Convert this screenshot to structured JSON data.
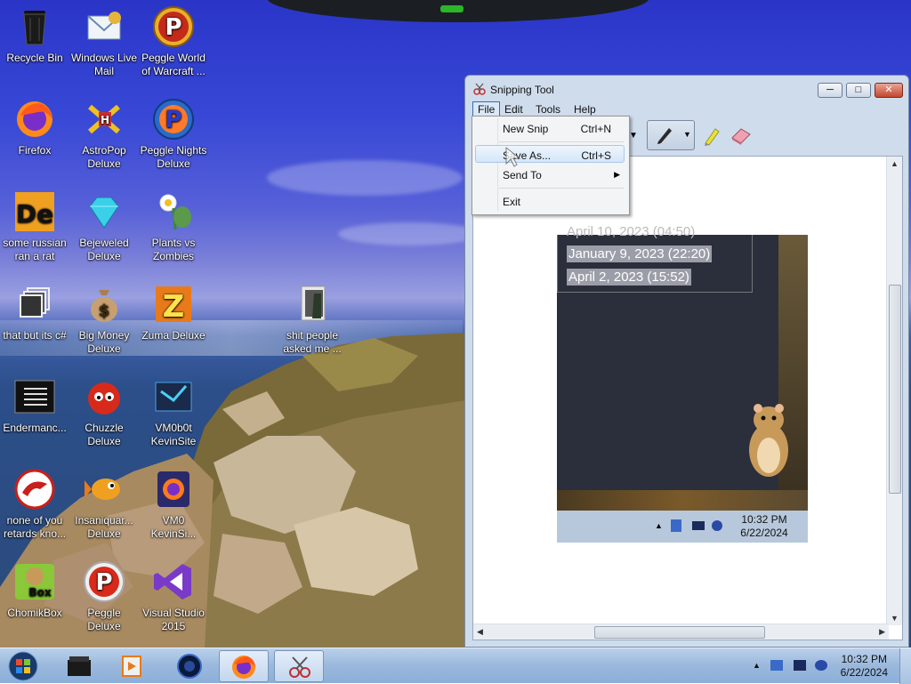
{
  "desktop_icons": [
    {
      "name": "recycle-bin",
      "label": "Recycle Bin"
    },
    {
      "name": "windows-live-mail",
      "label": "Windows Live Mail"
    },
    {
      "name": "peggle-world-of-warcraft",
      "label": "Peggle World of Warcraft ..."
    },
    {
      "name": "firefox",
      "label": "Firefox"
    },
    {
      "name": "astropop-deluxe",
      "label": "AstroPop Deluxe"
    },
    {
      "name": "peggle-nights-deluxe",
      "label": "Peggle Nights Deluxe"
    },
    {
      "name": "some-russian-ran-a-rat",
      "label": "some russian ran a rat"
    },
    {
      "name": "bejeweled-deluxe",
      "label": "Bejeweled Deluxe"
    },
    {
      "name": "plants-vs-zombies",
      "label": "Plants vs Zombies"
    },
    {
      "name": "that-but-its-csharp",
      "label": "that but its c#"
    },
    {
      "name": "big-money-deluxe",
      "label": "Big Money Deluxe"
    },
    {
      "name": "zuma-deluxe",
      "label": "Zuma Deluxe"
    },
    {
      "name": "shit-people-asked-me",
      "label": "shit people asked me ..."
    },
    {
      "name": "endermanc",
      "label": "Endermanc..."
    },
    {
      "name": "chuzzle-deluxe",
      "label": "Chuzzle Deluxe"
    },
    {
      "name": "vm0b0t-kevinsite",
      "label": "VM0b0t KevinSite"
    },
    {
      "name": "none-of-you-retards",
      "label": "none of you retards kno..."
    },
    {
      "name": "insaniquarium-deluxe",
      "label": "Insaniquar... Deluxe"
    },
    {
      "name": "vm0-kevinsi",
      "label": "VM0 KevinSi..."
    },
    {
      "name": "chomikbox",
      "label": "ChomikBox"
    },
    {
      "name": "peggle-deluxe",
      "label": "Peggle Deluxe"
    },
    {
      "name": "visual-studio-2015",
      "label": "Visual Studio 2015"
    }
  ],
  "snipping_tool": {
    "title": "Snipping Tool",
    "menus": [
      "File",
      "Edit",
      "Tools",
      "Help"
    ],
    "file_menu": {
      "items": [
        {
          "label": "New Snip",
          "shortcut": "Ctrl+N"
        },
        {
          "label": "Save As...",
          "shortcut": "Ctrl+S"
        },
        {
          "label": "Send To",
          "shortcut": ""
        },
        {
          "label": "Exit",
          "shortcut": ""
        }
      ]
    },
    "capture": {
      "line_cut": "April 10, 2023 (04:50)",
      "line1": "January 9, 2023 (22:20)",
      "line2": "April 2, 2023 (15:52)",
      "clock_time": "10:32 PM",
      "clock_date": "6/22/2024"
    }
  },
  "taskbar": {
    "clock_time": "10:32 PM",
    "clock_date": "6/22/2024"
  }
}
